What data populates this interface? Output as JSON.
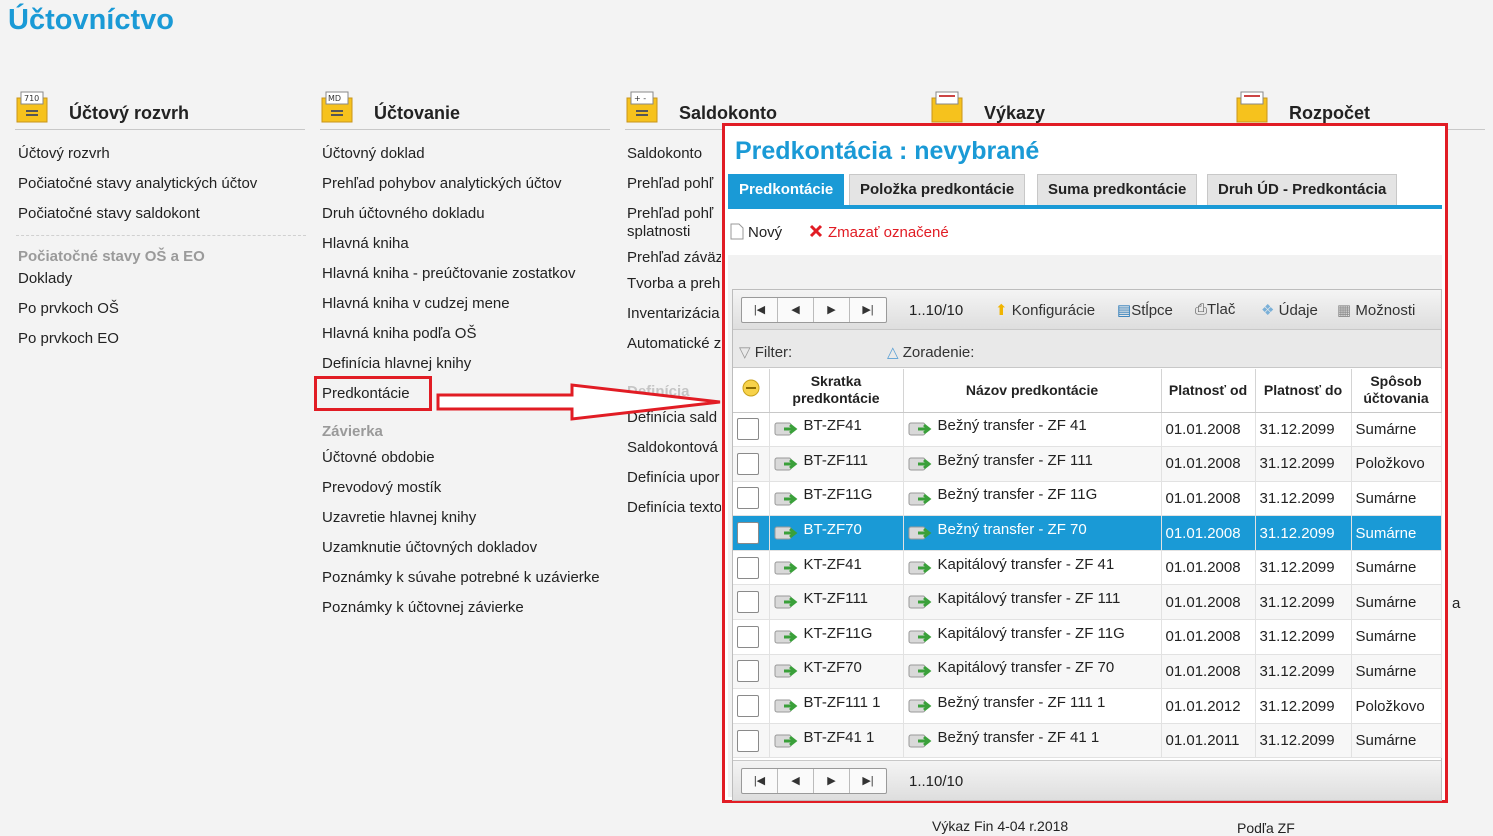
{
  "app_title": "Účtovníctvo",
  "modules": [
    {
      "title": "Účtový rozvrh",
      "icon": "account-chart-icon",
      "items": [
        "Účtový rozvrh",
        "Počiatočné stavy analytických účtov",
        "Počiatočné stavy saldokont"
      ],
      "section": "Počiatočné stavy OŠ a EO",
      "section_items": [
        "Doklady",
        "Po prvkoch OŠ",
        "Po prvkoch EO"
      ]
    },
    {
      "title": "Účtovanie",
      "icon": "accounting-icon",
      "items": [
        "Účtovný doklad",
        "Prehľad pohybov analytických účtov",
        "Druh účtovného dokladu",
        "Hlavná kniha",
        "Hlavná kniha - preúčtovanie zostatkov",
        "Hlavná kniha v cudzej mene",
        "Hlavná kniha podľa OŠ",
        "Definícia hlavnej knihy",
        "Predkontácie"
      ],
      "section": "Závierka",
      "section_items": [
        "Účtovné obdobie",
        "Prevodový mostík",
        "Uzavretie hlavnej knihy",
        "Uzamknutie účtovných dokladov",
        "Poznámky k súvahe potrebné k uzávierke",
        "Poznámky k účtovnej závierke"
      ]
    },
    {
      "title": "Saldokonto",
      "icon": "saldokonto-icon",
      "items": [
        "Saldokonto",
        "Prehľad pohľ",
        "Prehľad pohľ",
        "splatnosti",
        "Prehľad záväzkov",
        "Tvorba a preh",
        "Inventarizácia",
        "Automatické z"
      ],
      "section": "Definícia",
      "section_items": [
        "Definícia sald",
        "Saldokontová",
        "Definícia upor",
        "Definícia texto"
      ]
    },
    {
      "title": "Výkazy",
      "icon": "reports-icon",
      "footer_text": "Výkaz Fin 4-04 r.2018"
    },
    {
      "title": "Rozpočet",
      "icon": "budget-icon",
      "footer_text": "Podľa ZF",
      "side_fragment": "a"
    }
  ],
  "panel": {
    "title": "Predkontácia :  nevybrané",
    "tabs": [
      "Predkontácie",
      "Položka predkontácie",
      "Suma predkontácie",
      "Druh ÚD - Predkontácia"
    ],
    "toolbar": {
      "new_label": "Nový",
      "delete_label": "Zmazať označené"
    },
    "pager": {
      "range": "1..10/10",
      "config_label": "Konfigurácie",
      "columns_label": "Stĺpce",
      "print_label": "Tlač",
      "data_label": "Údaje",
      "options_label": "Možnosti"
    },
    "filter_label": "Filter:",
    "sort_label": "Zoradenie:",
    "columns": [
      "Skratka predkontácie",
      "Názov predkontácie",
      "Platnosť od",
      "Platnosť do",
      "Spôsob účtovania"
    ],
    "rows": [
      [
        "BT-ZF41",
        "Bežný transfer - ZF 41",
        "01.01.2008",
        "31.12.2099",
        "Sumárne"
      ],
      [
        "BT-ZF111",
        "Bežný transfer - ZF 111",
        "01.01.2008",
        "31.12.2099",
        "Položkovo"
      ],
      [
        "BT-ZF11G",
        "Bežný transfer - ZF 11G",
        "01.01.2008",
        "31.12.2099",
        "Sumárne"
      ],
      [
        "BT-ZF70",
        "Bežný transfer - ZF 70",
        "01.01.2008",
        "31.12.2099",
        "Sumárne"
      ],
      [
        "KT-ZF41",
        "Kapitálový transfer - ZF 41",
        "01.01.2008",
        "31.12.2099",
        "Sumárne"
      ],
      [
        "KT-ZF111",
        "Kapitálový transfer - ZF 111",
        "01.01.2008",
        "31.12.2099",
        "Sumárne"
      ],
      [
        "KT-ZF11G",
        "Kapitálový transfer - ZF 11G",
        "01.01.2008",
        "31.12.2099",
        "Sumárne"
      ],
      [
        "KT-ZF70",
        "Kapitálový transfer - ZF 70",
        "01.01.2008",
        "31.12.2099",
        "Sumárne"
      ],
      [
        "BT-ZF111 1",
        "Bežný transfer - ZF 111 1",
        "01.01.2012",
        "31.12.2099",
        "Položkovo"
      ],
      [
        "BT-ZF41 1",
        "Bežný transfer - ZF 41 1",
        "01.01.2011",
        "31.12.2099",
        "Sumárne"
      ]
    ],
    "selected_row": 3
  },
  "colors": {
    "accent": "#1a9ad6",
    "highlight_red": "#e11c24"
  }
}
